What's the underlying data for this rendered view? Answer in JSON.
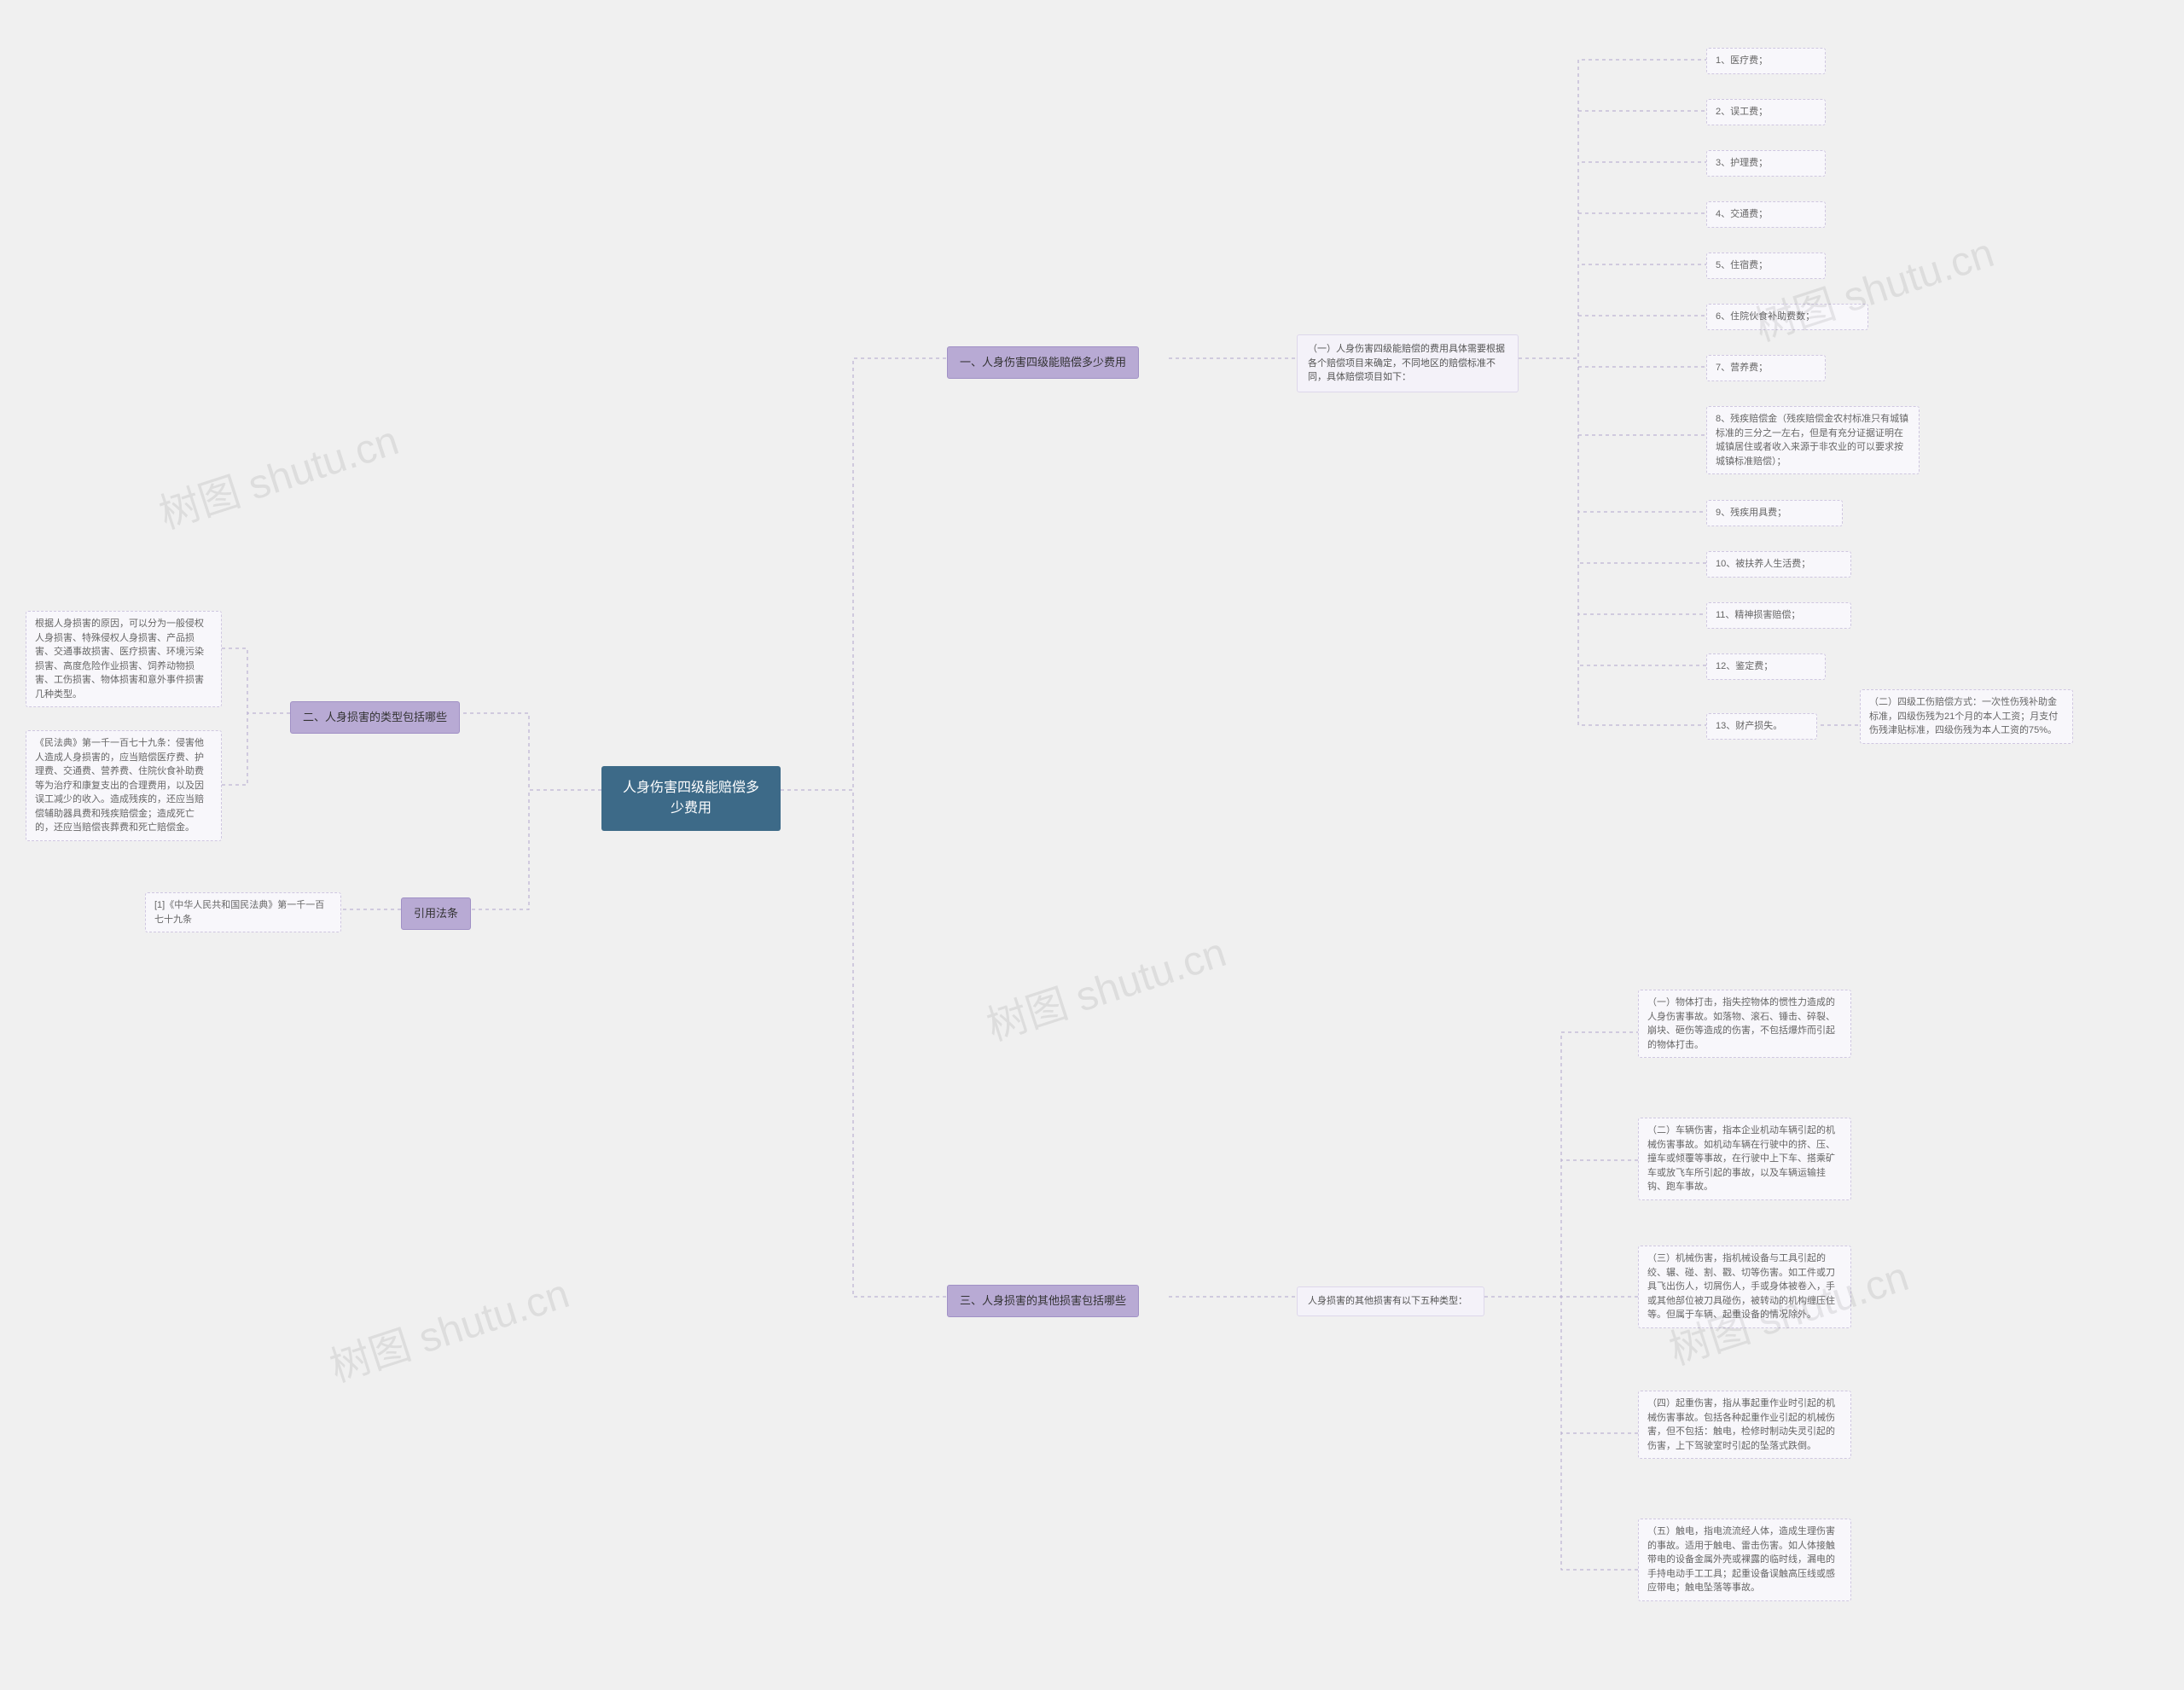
{
  "root": {
    "title": "人身伤害四级能赔偿多少费用"
  },
  "branches": {
    "b1": {
      "label": "一、人身伤害四级能赔偿多少费用"
    },
    "b2": {
      "label": "二、人身损害的类型包括哪些"
    },
    "b3": {
      "label": "三、人身损害的其他损害包括哪些"
    },
    "b4": {
      "label": "引用法条"
    }
  },
  "b1_sub": {
    "text": "（一）人身伤害四级能赔偿的费用具体需要根据各个赔偿项目来确定，不同地区的赔偿标准不同，具体赔偿项目如下："
  },
  "b1_leaves": {
    "i1": "1、医疗费；",
    "i2": "2、误工费；",
    "i3": "3、护理费；",
    "i4": "4、交通费；",
    "i5": "5、住宿费；",
    "i6": "6、住院伙食补助费数；",
    "i7": "7、营养费；",
    "i8": "8、残疾赔偿金（残疾赔偿金农村标准只有城镇标准的三分之一左右，但是有充分证据证明在城镇居住或者收入来源于非农业的可以要求按城镇标准赔偿）；",
    "i9": "9、残疾用具费；",
    "i10": "10、被扶养人生活费；",
    "i11": "11、精神损害赔偿；",
    "i12": "12、鉴定费；",
    "i13": "13、财产损失。",
    "i13_note": "（二）四级工伤赔偿方式：一次性伤残补助金标准，四级伤残为21个月的本人工资；月支付伤残津贴标准，四级伤残为本人工资的75%。"
  },
  "b2_leaves": {
    "l1": "根据人身损害的原因，可以分为一般侵权人身损害、特殊侵权人身损害、产品损害、交通事故损害、医疗损害、环境污染损害、高度危险作业损害、饲养动物损害、工伤损害、物体损害和意外事件损害几种类型。",
    "l2": "《民法典》第一千一百七十九条：侵害他人造成人身损害的，应当赔偿医疗费、护理费、交通费、营养费、住院伙食补助费等为治疗和康复支出的合理费用，以及因误工减少的收入。造成残疾的，还应当赔偿辅助器具费和残疾赔偿金；造成死亡的，还应当赔偿丧葬费和死亡赔偿金。"
  },
  "b3_sub": {
    "text": "人身损害的其他损害有以下五种类型："
  },
  "b3_leaves": {
    "t1": "（一）物体打击，指失控物体的惯性力造成的人身伤害事故。如落物、滚石、锤击、碎裂、崩块、砸伤等造成的伤害，不包括爆炸而引起的物体打击。",
    "t2": "（二）车辆伤害，指本企业机动车辆引起的机械伤害事故。如机动车辆在行驶中的挤、压、撞车或倾覆等事故，在行驶中上下车、搭乘矿车或放飞车所引起的事故，以及车辆运输挂钩、跑车事故。",
    "t3": "（三）机械伤害，指机械设备与工具引起的绞、辗、碰、割、戳、切等伤害。如工件或刀具飞出伤人，切屑伤人，手或身体被卷入，手或其他部位被刀具碰伤，被转动的机构缠压住等。但属于车辆、起重设备的情况除外。",
    "t4": "（四）起重伤害，指从事起重作业时引起的机械伤害事故。包括各种起重作业引起的机械伤害，但不包括：触电，检修时制动失灵引起的伤害，上下驾驶室时引起的坠落式跌倒。",
    "t5": "（五）触电，指电流流经人体，造成生理伤害的事故。适用于触电、雷击伤害。如人体接触带电的设备金属外壳或裸露的临时线，漏电的手持电动手工工具；起重设备误触高压线或感应带电；触电坠落等事故。"
  },
  "b4_leaf": {
    "text": "[1]《中华人民共和国民法典》第一千一百七十九条"
  },
  "watermark": "树图 shutu.cn"
}
